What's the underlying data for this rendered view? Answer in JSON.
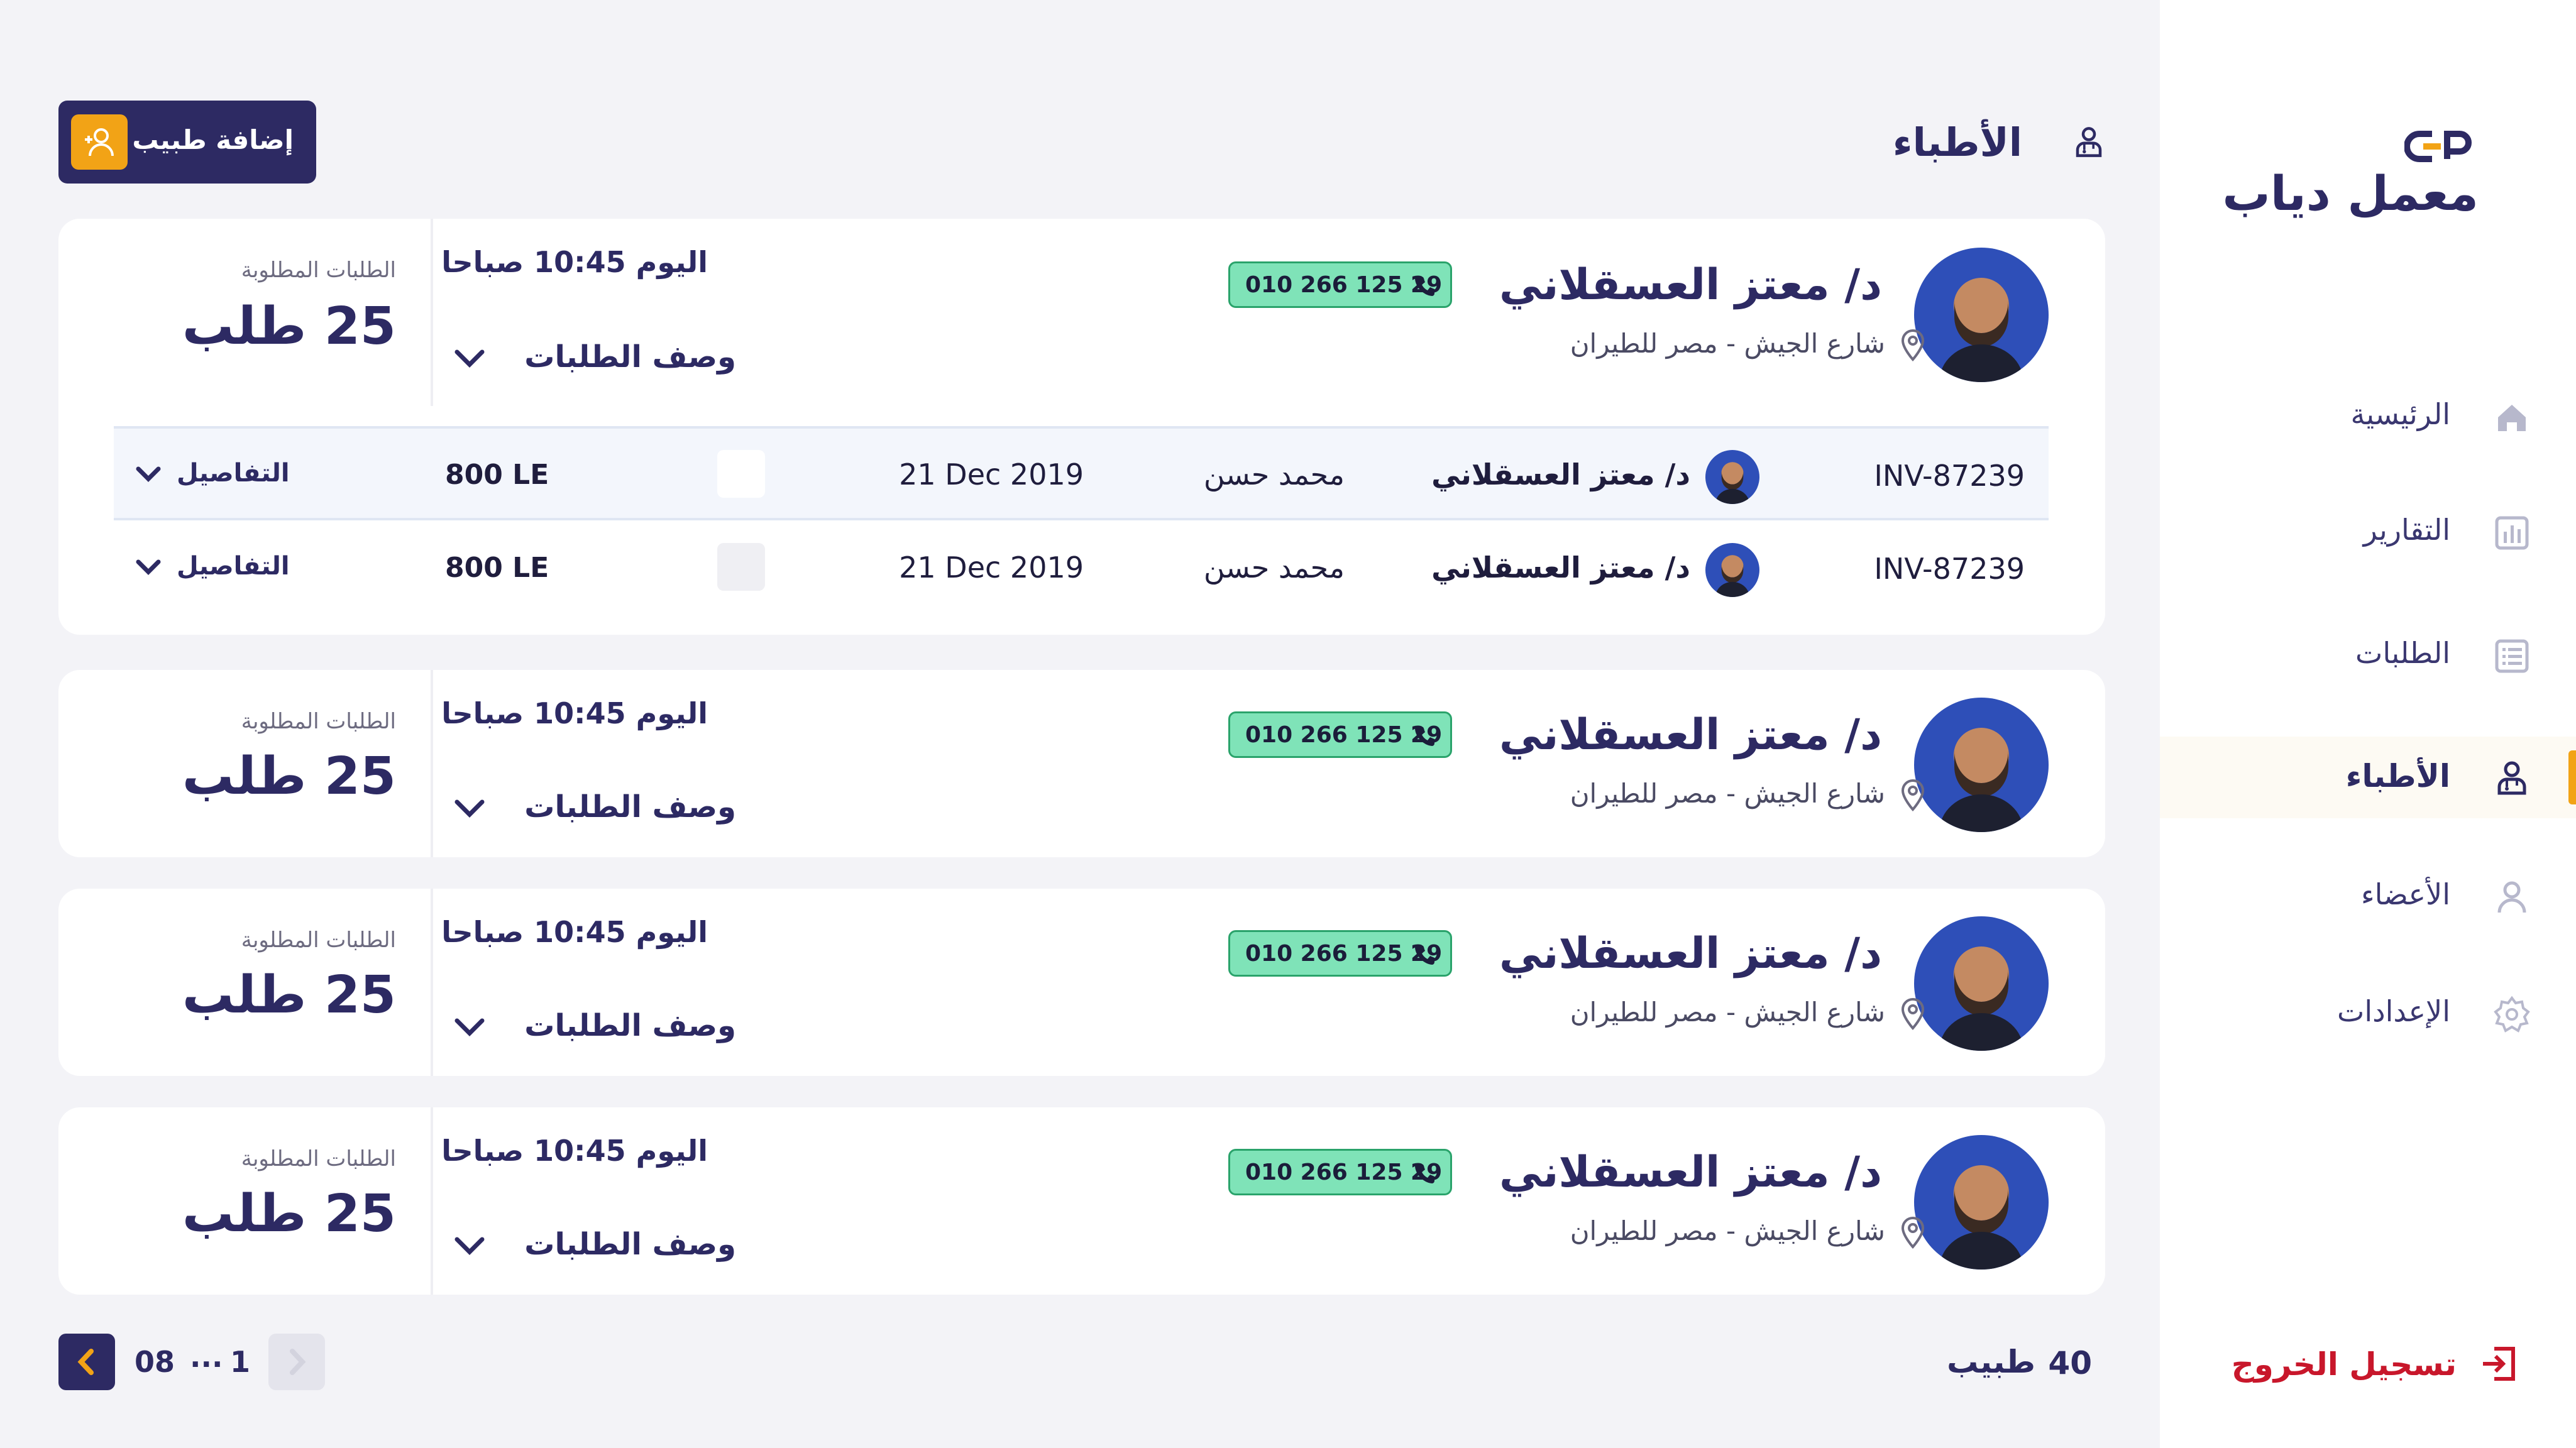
{
  "sidebar": {
    "logo_text": "معمل دياب",
    "items": [
      {
        "label": "الرئيسية",
        "icon": "home-icon"
      },
      {
        "label": "التقارير",
        "icon": "chart-icon"
      },
      {
        "label": "الطلبات",
        "icon": "list-icon"
      },
      {
        "label": "الأطباء",
        "icon": "doctor-icon",
        "active": true
      },
      {
        "label": "الأعضاء",
        "icon": "user-icon"
      },
      {
        "label": "الإعدادات",
        "icon": "settings-gear-icon"
      }
    ],
    "logout_label": "تسجيل الخروج"
  },
  "header": {
    "title": "الأطباء",
    "add_button_label": "إضافة طبيب"
  },
  "doctors": [
    {
      "name": "د/ معتز العسقلاني",
      "address": "شارع الجيش - مصر للطيران",
      "phone": "010 266 125 29",
      "time": "اليوم 10:45 صباحا",
      "desc_label": "وصف الطلبات",
      "requests_label": "الطلبات المطلوبة",
      "requests_count": "25 طلب",
      "expanded": true,
      "invoices": [
        {
          "id": "INV-87239",
          "doctor": "د/ معتز العسقلاني",
          "patient": "محمد حسن",
          "date": "21 Dec 2019",
          "amount": "800 LE",
          "details_label": "التفاصيل"
        },
        {
          "id": "INV-87239",
          "doctor": "د/ معتز العسقلاني",
          "patient": "محمد حسن",
          "date": "21 Dec 2019",
          "amount": "800 LE",
          "details_label": "التفاصيل"
        }
      ]
    },
    {
      "name": "د/ معتز العسقلاني",
      "address": "شارع الجيش - مصر للطيران",
      "phone": "010 266 125 29",
      "time": "اليوم 10:45 صباحا",
      "desc_label": "وصف الطلبات",
      "requests_label": "الطلبات المطلوبة",
      "requests_count": "25 طلب"
    },
    {
      "name": "د/ معتز العسقلاني",
      "address": "شارع الجيش - مصر للطيران",
      "phone": "010 266 125 29",
      "time": "اليوم 10:45 صباحا",
      "desc_label": "وصف الطلبات",
      "requests_label": "الطلبات المطلوبة",
      "requests_count": "25 طلب"
    },
    {
      "name": "د/ معتز العسقلاني",
      "address": "شارع الجيش - مصر للطيران",
      "phone": "010 266 125 29",
      "time": "اليوم 10:45 صباحا",
      "desc_label": "وصف الطلبات",
      "requests_label": "الطلبات المطلوبة",
      "requests_count": "25 طلب"
    }
  ],
  "pagination": {
    "total_count": "40",
    "total_label": "طبيب",
    "current_page": "1",
    "ellipsis": "...",
    "last_page": "08"
  },
  "colors": {
    "primary": "#2d2a63",
    "accent": "#f2a316",
    "phone_bg": "#7fe3b8",
    "logout": "#c8172b",
    "page_bg": "#f3f3f7"
  }
}
